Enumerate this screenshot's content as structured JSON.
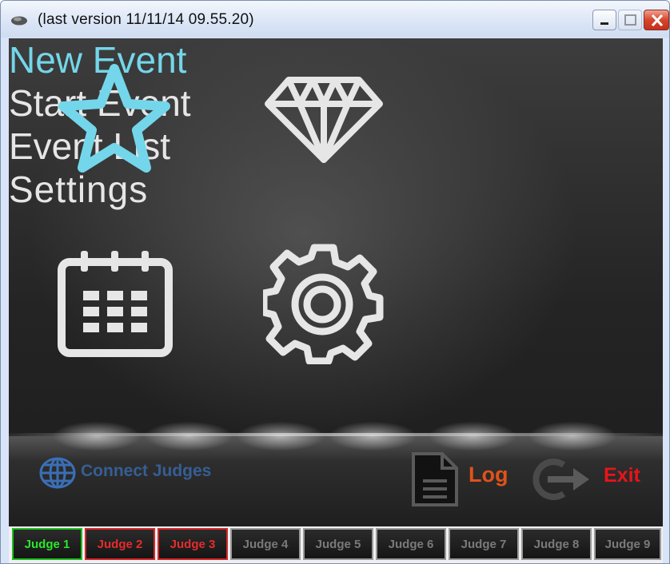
{
  "window": {
    "title": "(last version 11/11/14 09.55.20)"
  },
  "menu": {
    "new_event": "New Event",
    "start_event": "Start Event",
    "event_list": "Event List",
    "settings": "Settings"
  },
  "toolbar": {
    "connect_judges": "Connect Judges",
    "log": "Log",
    "exit": "Exit"
  },
  "judges": [
    {
      "label": "Judge 1",
      "status": "connected"
    },
    {
      "label": "Judge 2",
      "status": "error"
    },
    {
      "label": "Judge 3",
      "status": "error"
    },
    {
      "label": "Judge 4",
      "status": "inactive"
    },
    {
      "label": "Judge 5",
      "status": "inactive"
    },
    {
      "label": "Judge 6",
      "status": "inactive"
    },
    {
      "label": "Judge 7",
      "status": "inactive"
    },
    {
      "label": "Judge 8",
      "status": "inactive"
    },
    {
      "label": "Judge 9",
      "status": "inactive"
    }
  ],
  "colors": {
    "new_event": "#74d6ea",
    "log": "#e0521a",
    "exit": "#e8141a",
    "connected": "#2ae82a",
    "error": "#e62c2c"
  }
}
